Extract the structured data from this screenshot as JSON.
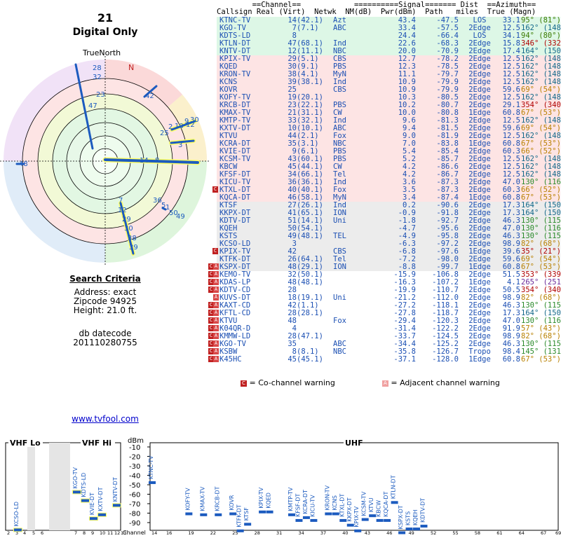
{
  "header": {
    "channel": "21",
    "mode": "Digital Only",
    "true_north": "TrueNorth",
    "north_mark": "N"
  },
  "search": {
    "title": "Search Criteria",
    "address": "Address: exact",
    "zipcode": "Zipcode 94925",
    "height": "Height: 21.0 ft.",
    "db_label": "db datecode",
    "db_value": "201110280755"
  },
  "link": "www.tvfool.com",
  "table": {
    "h1": "        ==Channel==            ==========Signal======= Dist  ==Azimuth==",
    "h2": "Callsign Real (Virt)  Netwk  NM(dB)  Pwr(dBm)  Path   miles  True (Magn)",
    "rows": [
      {
        "call": "KTNC-TV",
        "real": "14",
        "virt": "(42.1)",
        "net": "Azt",
        "nm": "43.4",
        "pwr": "-47.5",
        "path": "LOS",
        "dist": "33.1",
        "az": "95° (81°)",
        "bg": "#dfe",
        "azc": "#3a7a00",
        "mark": ""
      },
      {
        "call": "KGO-TV",
        "real": "7",
        "virt": "(7.1)",
        "net": "ABC",
        "nm": "33.4",
        "pwr": "-57.5",
        "path": "2Edge",
        "dist": "12.5",
        "az": "162° (148°)",
        "bg": "#dfe",
        "azc": "#13688a",
        "mark": ""
      },
      {
        "call": "KDTS-LD",
        "real": "8",
        "virt": "",
        "net": "",
        "nm": "24.4",
        "pwr": "-66.4",
        "path": "LOS",
        "dist": "34.1",
        "az": "94° (80°)",
        "bg": "#dfe",
        "azc": "#3a7a00",
        "mark": ""
      },
      {
        "call": "KTLN-DT",
        "real": "47",
        "virt": "(68.1)",
        "net": "Ind",
        "nm": "22.6",
        "pwr": "-68.3",
        "path": "2Edge",
        "dist": "15.8",
        "az": "346° (332°)",
        "bg": "#dfe",
        "azc": "#b00000",
        "mark": ""
      },
      {
        "call": "KNTV-DT",
        "real": "12",
        "virt": "(11.1)",
        "net": "NBC",
        "nm": "20.0",
        "pwr": "-70.9",
        "path": "2Edge",
        "dist": "17.4",
        "az": "164° (150°)",
        "bg": "#dfe",
        "azc": "#13688a",
        "mark": ""
      },
      {
        "call": "KPIX-TV",
        "real": "29",
        "virt": "(5.1)",
        "net": "CBS",
        "nm": "12.7",
        "pwr": "-78.2",
        "path": "2Edge",
        "dist": "12.5",
        "az": "162° (148°)",
        "bg": "#fee",
        "azc": "#13688a",
        "mark": ""
      },
      {
        "call": "KQED",
        "real": "30",
        "virt": "(9.1)",
        "net": "PBS",
        "nm": "12.3",
        "pwr": "-78.5",
        "path": "2Edge",
        "dist": "12.5",
        "az": "162° (148°)",
        "bg": "#fee",
        "azc": "#13688a",
        "mark": ""
      },
      {
        "call": "KRON-TV",
        "real": "38",
        "virt": "(4.1)",
        "net": "MyN",
        "nm": "11.1",
        "pwr": "-79.7",
        "path": "2Edge",
        "dist": "12.5",
        "az": "162° (148°)",
        "bg": "#fee",
        "azc": "#13688a",
        "mark": ""
      },
      {
        "call": "KCNS",
        "real": "39",
        "virt": "(38.1)",
        "net": "Ind",
        "nm": "10.9",
        "pwr": "-79.9",
        "path": "2Edge",
        "dist": "12.5",
        "az": "162° (148°)",
        "bg": "#fee",
        "azc": "#13688a",
        "mark": ""
      },
      {
        "call": "KOVR",
        "real": "25",
        "virt": "",
        "net": "CBS",
        "nm": "10.9",
        "pwr": "-79.9",
        "path": "2Edge",
        "dist": "59.6",
        "az": "69° (54°)",
        "bg": "#fee",
        "azc": "#b88000",
        "mark": ""
      },
      {
        "call": "KOFY-TV",
        "real": "19",
        "virt": "(20.1)",
        "net": "",
        "nm": "10.3",
        "pwr": "-80.5",
        "path": "2Edge",
        "dist": "12.5",
        "az": "162° (148°)",
        "bg": "#fee",
        "azc": "#13688a",
        "mark": ""
      },
      {
        "call": "KRCB-DT",
        "real": "23",
        "virt": "(22.1)",
        "net": "PBS",
        "nm": "10.2",
        "pwr": "-80.7",
        "path": "2Edge",
        "dist": "29.1",
        "az": "354° (340°)",
        "bg": "#fee",
        "azc": "#b00000",
        "mark": ""
      },
      {
        "call": "KMAX-TV",
        "real": "21",
        "virt": "(31.1)",
        "net": "CW",
        "nm": "10.0",
        "pwr": "-80.8",
        "path": "1Edge",
        "dist": "60.8",
        "az": "67° (53°)",
        "bg": "#fee",
        "azc": "#b88000",
        "mark": ""
      },
      {
        "call": "KMTP-TV",
        "real": "33",
        "virt": "(32.1)",
        "net": "Ind",
        "nm": "9.6",
        "pwr": "-81.3",
        "path": "2Edge",
        "dist": "12.5",
        "az": "162° (148°)",
        "bg": "#fee",
        "azc": "#13688a",
        "mark": ""
      },
      {
        "call": "KXTV-DT",
        "real": "10",
        "virt": "(10.1)",
        "net": "ABC",
        "nm": "9.4",
        "pwr": "-81.5",
        "path": "2Edge",
        "dist": "59.6",
        "az": "69° (54°)",
        "bg": "#fee",
        "azc": "#b88000",
        "mark": ""
      },
      {
        "call": "KTVU",
        "real": "44",
        "virt": "(2.1)",
        "net": "Fox",
        "nm": "9.0",
        "pwr": "-81.9",
        "path": "2Edge",
        "dist": "12.5",
        "az": "162° (148°)",
        "bg": "#fee",
        "azc": "#13688a",
        "mark": ""
      },
      {
        "call": "KCRA-DT",
        "real": "35",
        "virt": "(3.1)",
        "net": "NBC",
        "nm": "7.0",
        "pwr": "-83.8",
        "path": "1Edge",
        "dist": "60.8",
        "az": "67° (53°)",
        "bg": "#fee",
        "azc": "#b88000",
        "mark": ""
      },
      {
        "call": "KVIE-DT",
        "real": "9",
        "virt": "(6.1)",
        "net": "PBS",
        "nm": "5.4",
        "pwr": "-85.4",
        "path": "2Edge",
        "dist": "60.3",
        "az": "66° (52°)",
        "bg": "#fee",
        "azc": "#b88000",
        "mark": ""
      },
      {
        "call": "KCSM-TV",
        "real": "43",
        "virt": "(60.1)",
        "net": "PBS",
        "nm": "5.2",
        "pwr": "-85.7",
        "path": "2Edge",
        "dist": "12.5",
        "az": "162° (148°)",
        "bg": "#fee",
        "azc": "#13688a",
        "mark": ""
      },
      {
        "call": "KBCW",
        "real": "45",
        "virt": "(44.1)",
        "net": "CW",
        "nm": "4.2",
        "pwr": "-86.6",
        "path": "2Edge",
        "dist": "12.5",
        "az": "162° (148°)",
        "bg": "#fee",
        "azc": "#13688a",
        "mark": ""
      },
      {
        "call": "KFSF-DT",
        "real": "34",
        "virt": "(66.1)",
        "net": "Tel",
        "nm": "4.2",
        "pwr": "-86.7",
        "path": "2Edge",
        "dist": "12.5",
        "az": "162° (148°)",
        "bg": "#fee",
        "azc": "#13688a",
        "mark": ""
      },
      {
        "call": "KICU-TV",
        "real": "36",
        "virt": "(36.1)",
        "net": "Ind",
        "nm": "3.6",
        "pwr": "-87.3",
        "path": "2Edge",
        "dist": "47.0",
        "az": "130° (116°)",
        "bg": "#fee",
        "azc": "#2a8a2a",
        "mark": ""
      },
      {
        "call": "KTXL-DT",
        "real": "40",
        "virt": "(40.1)",
        "net": "Fox",
        "nm": "3.5",
        "pwr": "-87.3",
        "path": "2Edge",
        "dist": "60.3",
        "az": "66° (52°)",
        "bg": "#fee",
        "azc": "#b88000",
        "mark": "C"
      },
      {
        "call": "KQCA-DT",
        "real": "46",
        "virt": "(58.1)",
        "net": "MyN",
        "nm": "3.4",
        "pwr": "-87.4",
        "path": "1Edge",
        "dist": "60.8",
        "az": "67° (53°)",
        "bg": "#fee",
        "azc": "#b88000",
        "mark": ""
      },
      {
        "call": "KTSF",
        "real": "27",
        "virt": "(26.1)",
        "net": "Ind",
        "nm": "0.2",
        "pwr": "-90.6",
        "path": "2Edge",
        "dist": "17.3",
        "az": "164° (150°)",
        "bg": "#eee",
        "azc": "#13688a",
        "mark": ""
      },
      {
        "call": "KKPX-DT",
        "real": "41",
        "virt": "(65.1)",
        "net": "ION",
        "nm": "-0.9",
        "pwr": "-91.8",
        "path": "2Edge",
        "dist": "17.3",
        "az": "164° (150°)",
        "bg": "#eee",
        "azc": "#13688a",
        "mark": ""
      },
      {
        "call": "KDTV-DT",
        "real": "51",
        "virt": "(14.1)",
        "net": "Uni",
        "nm": "-1.8",
        "pwr": "-92.7",
        "path": "2Edge",
        "dist": "46.3",
        "az": "130° (115°)",
        "bg": "#eee",
        "azc": "#2a8a2a",
        "mark": ""
      },
      {
        "call": "KQEH",
        "real": "50",
        "virt": "(54.1)",
        "net": "",
        "nm": "-4.7",
        "pwr": "-95.6",
        "path": "2Edge",
        "dist": "47.0",
        "az": "130° (116°)",
        "bg": "#eee",
        "azc": "#2a8a2a",
        "mark": ""
      },
      {
        "call": "KSTS",
        "real": "49",
        "virt": "(48.1)",
        "net": "TEL",
        "nm": "-4.9",
        "pwr": "-95.8",
        "path": "2Edge",
        "dist": "46.3",
        "az": "130° (115°)",
        "bg": "#eee",
        "azc": "#2a8a2a",
        "mark": ""
      },
      {
        "call": "KCSO-LD",
        "real": "3",
        "virt": "",
        "net": "",
        "nm": "-6.3",
        "pwr": "-97.2",
        "path": "2Edge",
        "dist": "98.9",
        "az": "82° (68°)",
        "bg": "#eee",
        "azc": "#b88000",
        "mark": ""
      },
      {
        "call": "KPIX-TV",
        "real": "42",
        "virt": "",
        "net": "CBS",
        "nm": "-6.8",
        "pwr": "-97.6",
        "path": "1Edge",
        "dist": "39.6",
        "az": "35° (21°)",
        "bg": "#eee",
        "azc": "#b00000",
        "mark": "C"
      },
      {
        "call": "KTFK-DT",
        "real": "26",
        "virt": "(64.1)",
        "net": "Tel",
        "nm": "-7.2",
        "pwr": "-98.0",
        "path": "2Edge",
        "dist": "59.6",
        "az": "69° (54°)",
        "bg": "#eee",
        "azc": "#b88000",
        "mark": ""
      },
      {
        "call": "KSPX-DT",
        "real": "48",
        "virt": "(29.1)",
        "net": "ION",
        "nm": "-8.8",
        "pwr": "-99.7",
        "path": "1Edge",
        "dist": "60.8",
        "az": "67° (53°)",
        "bg": "#eee",
        "azc": "#b88000",
        "mark": "CA"
      },
      {
        "call": "KEMO-TV",
        "real": "32",
        "virt": "(50.1)",
        "net": "",
        "nm": "-15.9",
        "pwr": "-106.8",
        "path": "2Edge",
        "dist": "51.5",
        "az": "353° (339°)",
        "bg": "#fff",
        "azc": "#b00000",
        "mark": "CA"
      },
      {
        "call": "KDAS-LP",
        "real": "48",
        "virt": "(48.1)",
        "net": "",
        "nm": "-16.3",
        "pwr": "-107.2",
        "path": "1Edge",
        "dist": "4.1",
        "az": "265° (251°)",
        "bg": "#fff",
        "azc": "#6a2a9a",
        "mark": "CA"
      },
      {
        "call": "KDTV-CD",
        "real": "28",
        "virt": "",
        "net": "",
        "nm": "-19.9",
        "pwr": "-110.7",
        "path": "2Edge",
        "dist": "50.5",
        "az": "354° (340°)",
        "bg": "#fff",
        "azc": "#b00000",
        "mark": "CA"
      },
      {
        "call": "KUVS-DT",
        "real": "18",
        "virt": "(19.1)",
        "net": "Uni",
        "nm": "-21.2",
        "pwr": "-112.0",
        "path": "2Edge",
        "dist": "98.9",
        "az": "82° (68°)",
        "bg": "#fff",
        "azc": "#b88000",
        "mark": "A"
      },
      {
        "call": "KAXT-CD",
        "real": "42",
        "virt": "(1.1)",
        "net": "",
        "nm": "-27.2",
        "pwr": "-118.1",
        "path": "2Edge",
        "dist": "46.3",
        "az": "130° (115°)",
        "bg": "#fff",
        "azc": "#2a8a2a",
        "mark": "CA"
      },
      {
        "call": "KFTL-CD",
        "real": "28",
        "virt": "(28.1)",
        "net": "",
        "nm": "-27.8",
        "pwr": "-118.7",
        "path": "2Edge",
        "dist": "17.3",
        "az": "164° (150°)",
        "bg": "#fff",
        "azc": "#13688a",
        "mark": "CA"
      },
      {
        "call": "KTVU",
        "real": "48",
        "virt": "",
        "net": "Fox",
        "nm": "-29.4",
        "pwr": "-120.3",
        "path": "2Edge",
        "dist": "47.0",
        "az": "130° (116°)",
        "bg": "#fff",
        "azc": "#2a8a2a",
        "mark": "CA"
      },
      {
        "call": "K04QR-D",
        "real": "4",
        "virt": "",
        "net": "",
        "nm": "-31.4",
        "pwr": "-122.2",
        "path": "2Edge",
        "dist": "91.9",
        "az": "57° (43°)",
        "bg": "#fff",
        "azc": "#b88000",
        "mark": "CA"
      },
      {
        "call": "KMMW-LD",
        "real": "28",
        "virt": "(47.1)",
        "net": "",
        "nm": "-33.7",
        "pwr": "-124.5",
        "path": "2Edge",
        "dist": "98.9",
        "az": "82° (68°)",
        "bg": "#fff",
        "azc": "#b88000",
        "mark": "CA"
      },
      {
        "call": "KGO-TV",
        "real": "35",
        "virt": "",
        "net": "ABC",
        "nm": "-34.4",
        "pwr": "-125.2",
        "path": "2Edge",
        "dist": "46.3",
        "az": "130° (115°)",
        "bg": "#fff",
        "azc": "#2a8a2a",
        "mark": "CA"
      },
      {
        "call": "KSBW",
        "real": "8",
        "virt": "(8.1)",
        "net": "NBC",
        "nm": "-35.8",
        "pwr": "-126.7",
        "path": "Tropo",
        "dist": "98.4",
        "az": "145° (131°)",
        "bg": "#fff",
        "azc": "#2a8a2a",
        "mark": "CA"
      },
      {
        "call": "K45HC",
        "real": "45",
        "virt": "(45.1)",
        "net": "",
        "nm": "-37.1",
        "pwr": "-128.0",
        "path": "1Edge",
        "dist": "60.8",
        "az": "67° (53°)",
        "bg": "#fff",
        "azc": "#b88000",
        "mark": "CA"
      }
    ]
  },
  "legend": {
    "co_mark": "C",
    "co": "= Co-channel warning",
    "adj_mark": "A",
    "adj": "= Adjacent channel warning"
  },
  "spectrum": {
    "vhf_lo": "VHF Lo",
    "vhf_hi": "VHF Hi",
    "uhf": "UHF",
    "dbm": "dBm",
    "channel": "Channel",
    "y_ticks": [
      "-10",
      "-20",
      "-30",
      "-40",
      "-50",
      "-60",
      "-70",
      "-80",
      "-90"
    ],
    "stations": [
      {
        "label": "KCSO-LD",
        "ch": 3,
        "dbm": -97
      },
      {
        "label": "KGO-TV",
        "ch": 7,
        "dbm": -57
      },
      {
        "label": "KDTS-LD",
        "ch": 8,
        "dbm": -66
      },
      {
        "label": "KVIE-DT",
        "ch": 9,
        "dbm": -85
      },
      {
        "label": "KXTV-DT",
        "ch": 10,
        "dbm": -81
      },
      {
        "label": "KNTV-DT",
        "ch": 12,
        "dbm": -71
      },
      {
        "label": "KTNC-TV",
        "ch": 14,
        "dbm": -47
      },
      {
        "label": "KOFY-TV",
        "ch": 19,
        "dbm": -80
      },
      {
        "label": "KMAX-TV",
        "ch": 21,
        "dbm": -81
      },
      {
        "label": "KRCB-DT",
        "ch": 23,
        "dbm": -81
      },
      {
        "label": "KOVR",
        "ch": 25,
        "dbm": -80
      },
      {
        "label": "KTFK-DT",
        "ch": 26,
        "dbm": -98
      },
      {
        "label": "KTSF",
        "ch": 27,
        "dbm": -91
      },
      {
        "label": "KPIX-TV",
        "ch": 29,
        "dbm": -78
      },
      {
        "label": "KQED",
        "ch": 30,
        "dbm": -78
      },
      {
        "label": "KMTP-TV",
        "ch": 33,
        "dbm": -81
      },
      {
        "label": "KFSF-DT",
        "ch": 34,
        "dbm": -87
      },
      {
        "label": "KCRA-DT",
        "ch": 35,
        "dbm": -84
      },
      {
        "label": "KICU-TV",
        "ch": 36,
        "dbm": -87
      },
      {
        "label": "KRON-TV",
        "ch": 38,
        "dbm": -80
      },
      {
        "label": "KCNS",
        "ch": 39,
        "dbm": -80
      },
      {
        "label": "KTXL-DT",
        "ch": 40,
        "dbm": -87
      },
      {
        "label": "KKPX-DT",
        "ch": 41,
        "dbm": -92
      },
      {
        "label": "KPIX-TV",
        "ch": 42,
        "dbm": -98
      },
      {
        "label": "KCSM-TV",
        "ch": 43,
        "dbm": -86
      },
      {
        "label": "KTVU",
        "ch": 44,
        "dbm": -82
      },
      {
        "label": "KBCW",
        "ch": 45,
        "dbm": -87
      },
      {
        "label": "KQCA-DT",
        "ch": 46,
        "dbm": -87
      },
      {
        "label": "KTLN-DT",
        "ch": 47,
        "dbm": -68
      },
      {
        "label": "KSPX-DT",
        "ch": 48,
        "dbm": -100
      },
      {
        "label": "KSTS",
        "ch": 49,
        "dbm": -96
      },
      {
        "label": "KQEH",
        "ch": 50,
        "dbm": -96
      },
      {
        "label": "KDTV-DT",
        "ch": 51,
        "dbm": -93
      }
    ],
    "x_ticks": [
      "2",
      "3",
      "4",
      "5",
      "6",
      "7",
      "8",
      "9",
      "10",
      "11",
      "12",
      "13",
      "14",
      "16",
      "19",
      "22",
      "25",
      "28",
      "31",
      "34",
      "37",
      "40",
      "43",
      "46",
      "49",
      "52",
      "55",
      "58",
      "61",
      "64",
      "67",
      "69"
    ]
  },
  "colors": {
    "rowGreen": "#ddf7e6",
    "rowPink": "#fde4e4",
    "rowGray": "#ececec",
    "bar": "#1c5bbf",
    "barHi": "#ffff66",
    "warn": "#c02020"
  }
}
